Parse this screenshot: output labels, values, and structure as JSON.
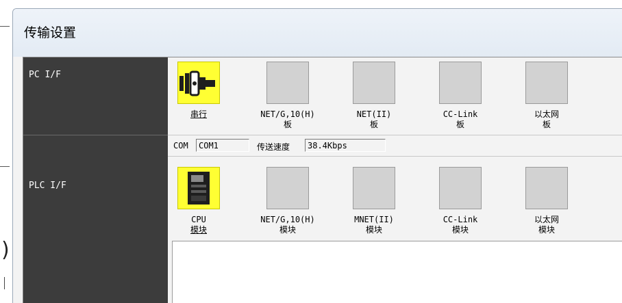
{
  "window": {
    "title": "传输设置"
  },
  "rows": {
    "pc_label": "PC I/F",
    "plc_label": "PLC I/F"
  },
  "pc_items": [
    {
      "line1": "串行",
      "line2": "",
      "selected": true,
      "icon": "serial-port-icon"
    },
    {
      "line1": "NET/G,10(H)",
      "line2": "板",
      "selected": false
    },
    {
      "line1": "NET(II)",
      "line2": "板",
      "selected": false
    },
    {
      "line1": "CC-Link",
      "line2": "板",
      "selected": false
    },
    {
      "line1": "以太网",
      "line2": "板",
      "selected": false
    }
  ],
  "com_settings": {
    "com_label": "COM",
    "com_value": "COM1",
    "speed_label": "传送速度",
    "speed_value": "38.4Kbps"
  },
  "plc_items": [
    {
      "line1": "CPU",
      "line2": "模块",
      "selected": true,
      "icon": "cpu-module-icon"
    },
    {
      "line1": "NET/G,10(H)",
      "line2": "模块",
      "selected": false
    },
    {
      "line1": "MNET(II)",
      "line2": "模块",
      "selected": false
    },
    {
      "line1": "CC-Link",
      "line2": "模块",
      "selected": false
    },
    {
      "line1": "以太网",
      "line2": "模块",
      "selected": false
    }
  ],
  "colors": {
    "selected_bg": "#ffff33",
    "left_column": "#3c3c3c",
    "unselected_box": "#d2d2d2"
  }
}
